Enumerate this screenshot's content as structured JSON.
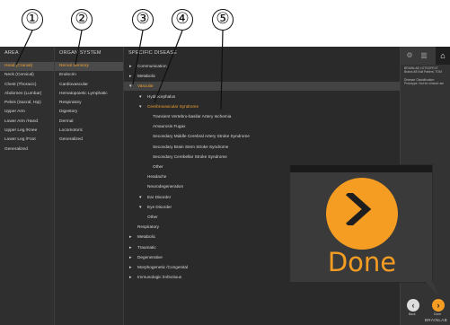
{
  "callouts": [
    "①",
    "②",
    "③",
    "④",
    "⑤"
  ],
  "area": {
    "header": "AREA",
    "items": [
      "Head (Cranial)",
      "Neck (Cervical)",
      "Chest (Thoracic)",
      "Abdomen (Lumbar)",
      "Pelvis (Sacral, Hip)",
      "Upper Arm",
      "Lower Arm /Hand",
      "Upper Leg /Knee",
      "Lower Leg /Foot",
      "Generalized"
    ],
    "selected_index": 0
  },
  "organ": {
    "header": "ORGAN SYSTEM",
    "items": [
      "Nerval Sensory",
      "Endocrin",
      "Cardiovascular",
      "Hematopoietic Lymphatic",
      "Respiratory",
      "Digestory",
      "Dermal",
      "Locomotoric",
      "Generalized"
    ],
    "selected_index": 0
  },
  "disease": {
    "header": "SPECIFIC DISEASE",
    "rows": [
      {
        "label": "Communication",
        "arrow": "▸",
        "indent": 0
      },
      {
        "label": "Metabolic",
        "arrow": "▸",
        "indent": 0
      },
      {
        "label": "Vascular",
        "arrow": "▾",
        "indent": 0
      },
      {
        "label": "Hydrocephalus",
        "arrow": "▾",
        "indent": 1
      },
      {
        "label": "Cerebrovascular Syndrome",
        "arrow": "▾",
        "indent": 1
      },
      {
        "label": "Transient Vertebro-basilar Artery Ischemia",
        "arrow": "",
        "indent": 2
      },
      {
        "label": "Amaurosis Fugax",
        "arrow": "",
        "indent": 2
      },
      {
        "label": "Secondary Middle Cerebral Artery Stroke Syndrome",
        "arrow": "",
        "indent": 2
      },
      {
        "label": "Secondary Brain Stem Stroke Syndrome",
        "arrow": "",
        "indent": 2
      },
      {
        "label": "Secondary Cerebellar Stroke Syndrome",
        "arrow": "",
        "indent": 2
      },
      {
        "label": "Other",
        "arrow": "",
        "indent": 2
      },
      {
        "label": "Headache",
        "arrow": "",
        "indent": 1
      },
      {
        "label": "Neurodegeneration",
        "arrow": "",
        "indent": 1
      },
      {
        "label": "Ear Disorder",
        "arrow": "▾",
        "indent": 1
      },
      {
        "label": "Eye Disorder",
        "arrow": "▾",
        "indent": 1
      },
      {
        "label": "Other",
        "arrow": "",
        "indent": 1
      },
      {
        "label": "Respiratory",
        "arrow": "",
        "indent": 0
      },
      {
        "label": "Metabolic",
        "arrow": "▸",
        "indent": 0
      },
      {
        "label": "Traumatic",
        "arrow": "▸",
        "indent": 0
      },
      {
        "label": "Degenerative",
        "arrow": "▸",
        "indent": 0
      },
      {
        "label": "Morphogenetic /Congenital",
        "arrow": "▸",
        "indent": 0
      },
      {
        "label": "Immunologic /Infectious",
        "arrow": "▸",
        "indent": 0
      }
    ],
    "highlighted_row": 2,
    "orange_rows": [
      2,
      4
    ]
  },
  "side": {
    "info_line1": "BRAINLAB LOTSOFEXT",
    "info_line2": "Brains 88 Null Patient, TOM",
    "classification_label": "Disease Classification:",
    "classification_value": "Prototype. Not for clinical use",
    "back_label": "Back",
    "done_label": "Done",
    "brand": "BRAINLAB"
  },
  "zoom": {
    "label": "Done"
  },
  "colors": {
    "accent": "#f59d23",
    "background": "#2b2b2b",
    "text": "#d8d8d8"
  }
}
